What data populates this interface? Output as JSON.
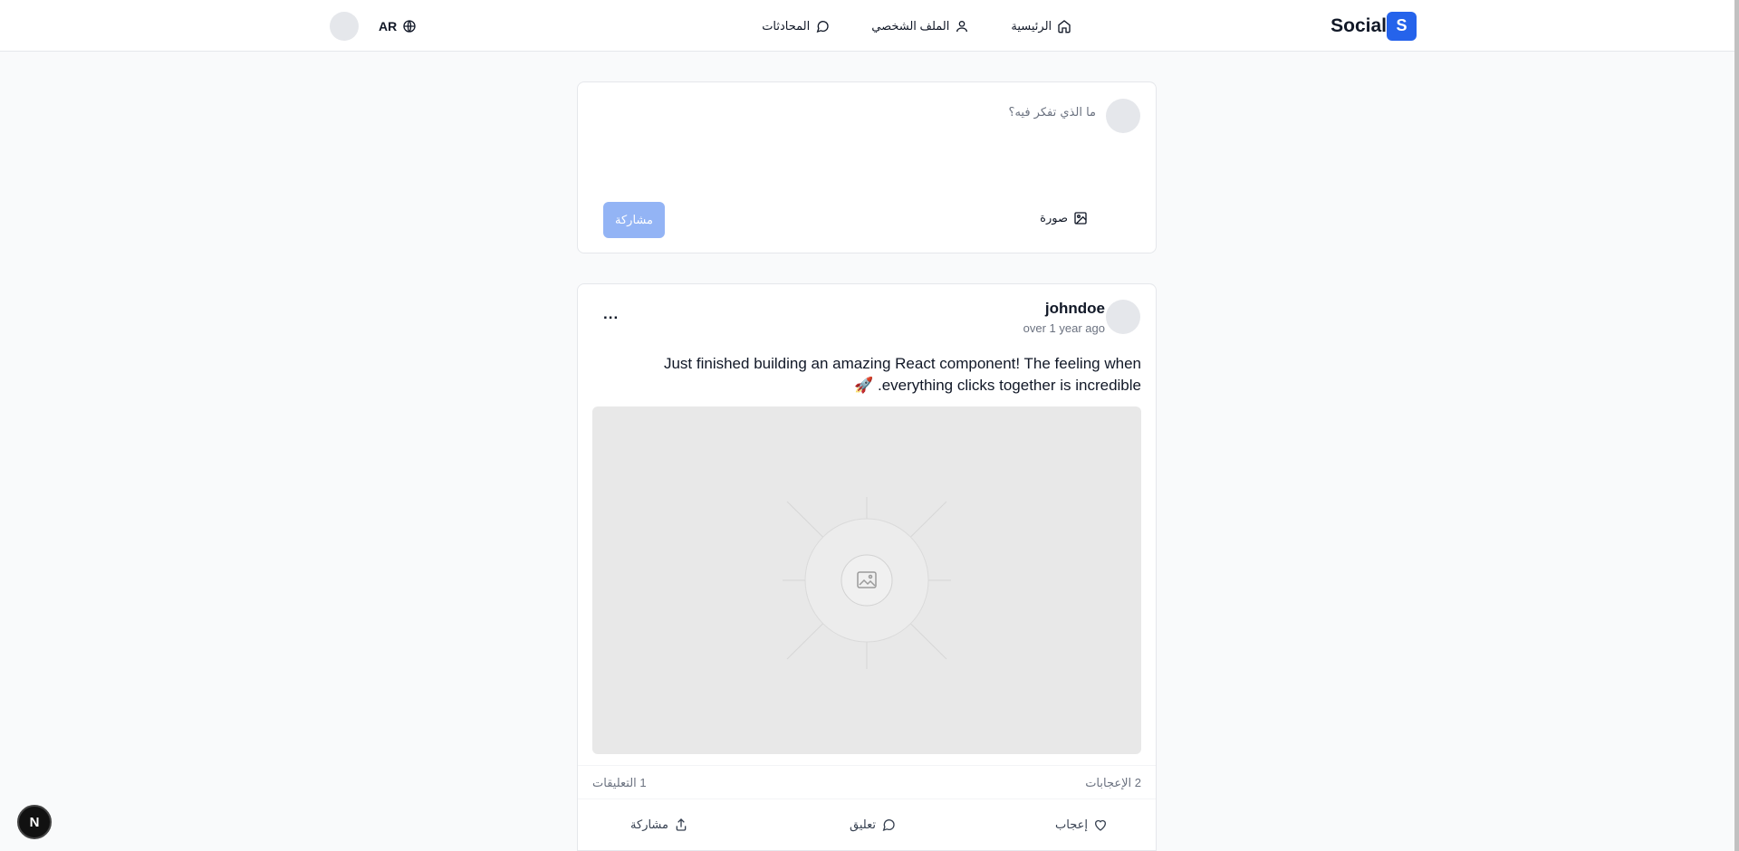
{
  "header": {
    "brand_letter": "S",
    "brand_name": "Social",
    "nav": [
      {
        "label": "الرئيسية",
        "icon": "home-icon"
      },
      {
        "label": "الملف الشخصي",
        "icon": "user-icon"
      },
      {
        "label": "المحادثات",
        "icon": "chat-icon"
      }
    ],
    "language": "AR"
  },
  "composer": {
    "placeholder": "ما الذي تفكر فيه؟",
    "photo_label": "صورة",
    "share_label": "مشاركة"
  },
  "post": {
    "username": "johndoe",
    "time": "over 1 year ago",
    "more": "...",
    "text": "Just finished building an amazing React component! The feeling when everything clicks together is incredible. 🚀",
    "likes": "2 الإعجابات",
    "comments": "1 التعليقات",
    "actions": {
      "like": "إعجاب",
      "comment": "تعليق",
      "share": "مشاركة"
    }
  },
  "dev_badge": "N"
}
